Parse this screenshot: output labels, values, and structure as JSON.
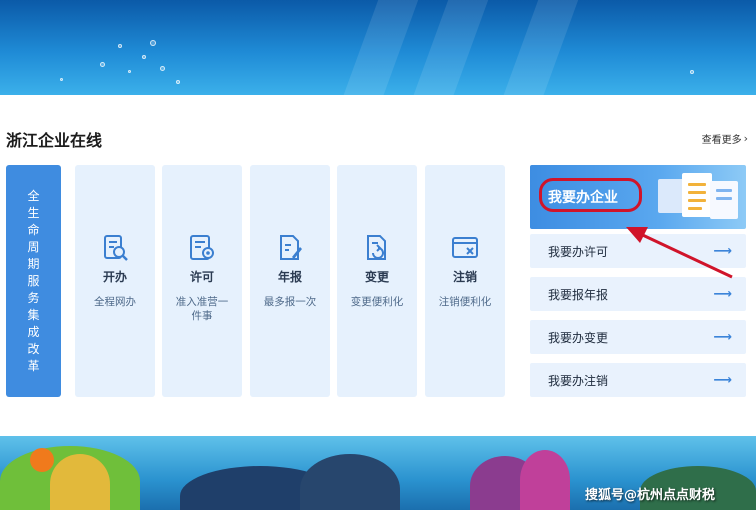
{
  "panel": {
    "title": "浙江企业在线",
    "more_label": "查看更多",
    "more_chevron": "›"
  },
  "reform": {
    "label": "全生命周期服务集成改革"
  },
  "services": [
    {
      "id": "start",
      "name": "开办",
      "desc": "全程网办",
      "icon": "magnifier-doc-icon"
    },
    {
      "id": "permit",
      "name": "许可",
      "desc": "准入准营一件事",
      "icon": "certificate-icon"
    },
    {
      "id": "annual",
      "name": "年报",
      "desc": "最多报一次",
      "icon": "edit-doc-icon"
    },
    {
      "id": "change",
      "name": "变更",
      "desc": "变更便利化",
      "icon": "refresh-doc-icon"
    },
    {
      "id": "cancel",
      "name": "注销",
      "desc": "注销便利化",
      "icon": "window-close-icon"
    }
  ],
  "feature": {
    "label": "我要办企业",
    "highlight_color": "#d0142a"
  },
  "actions": [
    {
      "label": "我要办许可",
      "arrow": "⟶"
    },
    {
      "label": "我要报年报",
      "arrow": "⟶"
    },
    {
      "label": "我要办变更",
      "arrow": "⟶"
    },
    {
      "label": "我要办注销",
      "arrow": "⟶"
    }
  ],
  "watermark": "搜狐号@杭州点点财税",
  "colors": {
    "accent": "#3f8ce0",
    "card_bg": "#e6f1fd",
    "annotation_red": "#d0142a"
  }
}
